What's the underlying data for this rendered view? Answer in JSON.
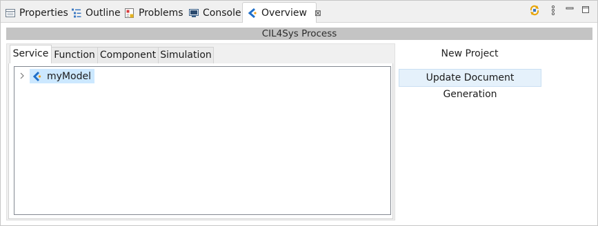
{
  "view_tabs": [
    {
      "label": "Properties",
      "icon": "properties-icon",
      "active": false
    },
    {
      "label": "Outline",
      "icon": "outline-icon",
      "active": false
    },
    {
      "label": "Problems",
      "icon": "problems-icon",
      "active": false
    },
    {
      "label": "Console",
      "icon": "console-icon",
      "active": false
    },
    {
      "label": "Overview",
      "icon": "capella-icon",
      "active": true
    }
  ],
  "toolbar": {
    "icons": [
      "sync-icon",
      "view-menu-icon",
      "minimize-icon",
      "maximize-icon"
    ]
  },
  "overview": {
    "process_title": "CIL4Sys Process",
    "tabs": [
      "Service",
      "Function",
      "Component",
      "Simulation"
    ],
    "active_tab": "Service",
    "tree": {
      "items": [
        {
          "label": "myModel",
          "icon": "capella-model-icon",
          "expanded": false,
          "selected": true
        }
      ]
    },
    "side_panel": {
      "title": "New Project",
      "button_label": "Update Document Generation"
    }
  },
  "colors": {
    "selection": "#cce8ff",
    "process_bar": "#c4c4c4",
    "capella_accent": "#1f6fc9"
  }
}
